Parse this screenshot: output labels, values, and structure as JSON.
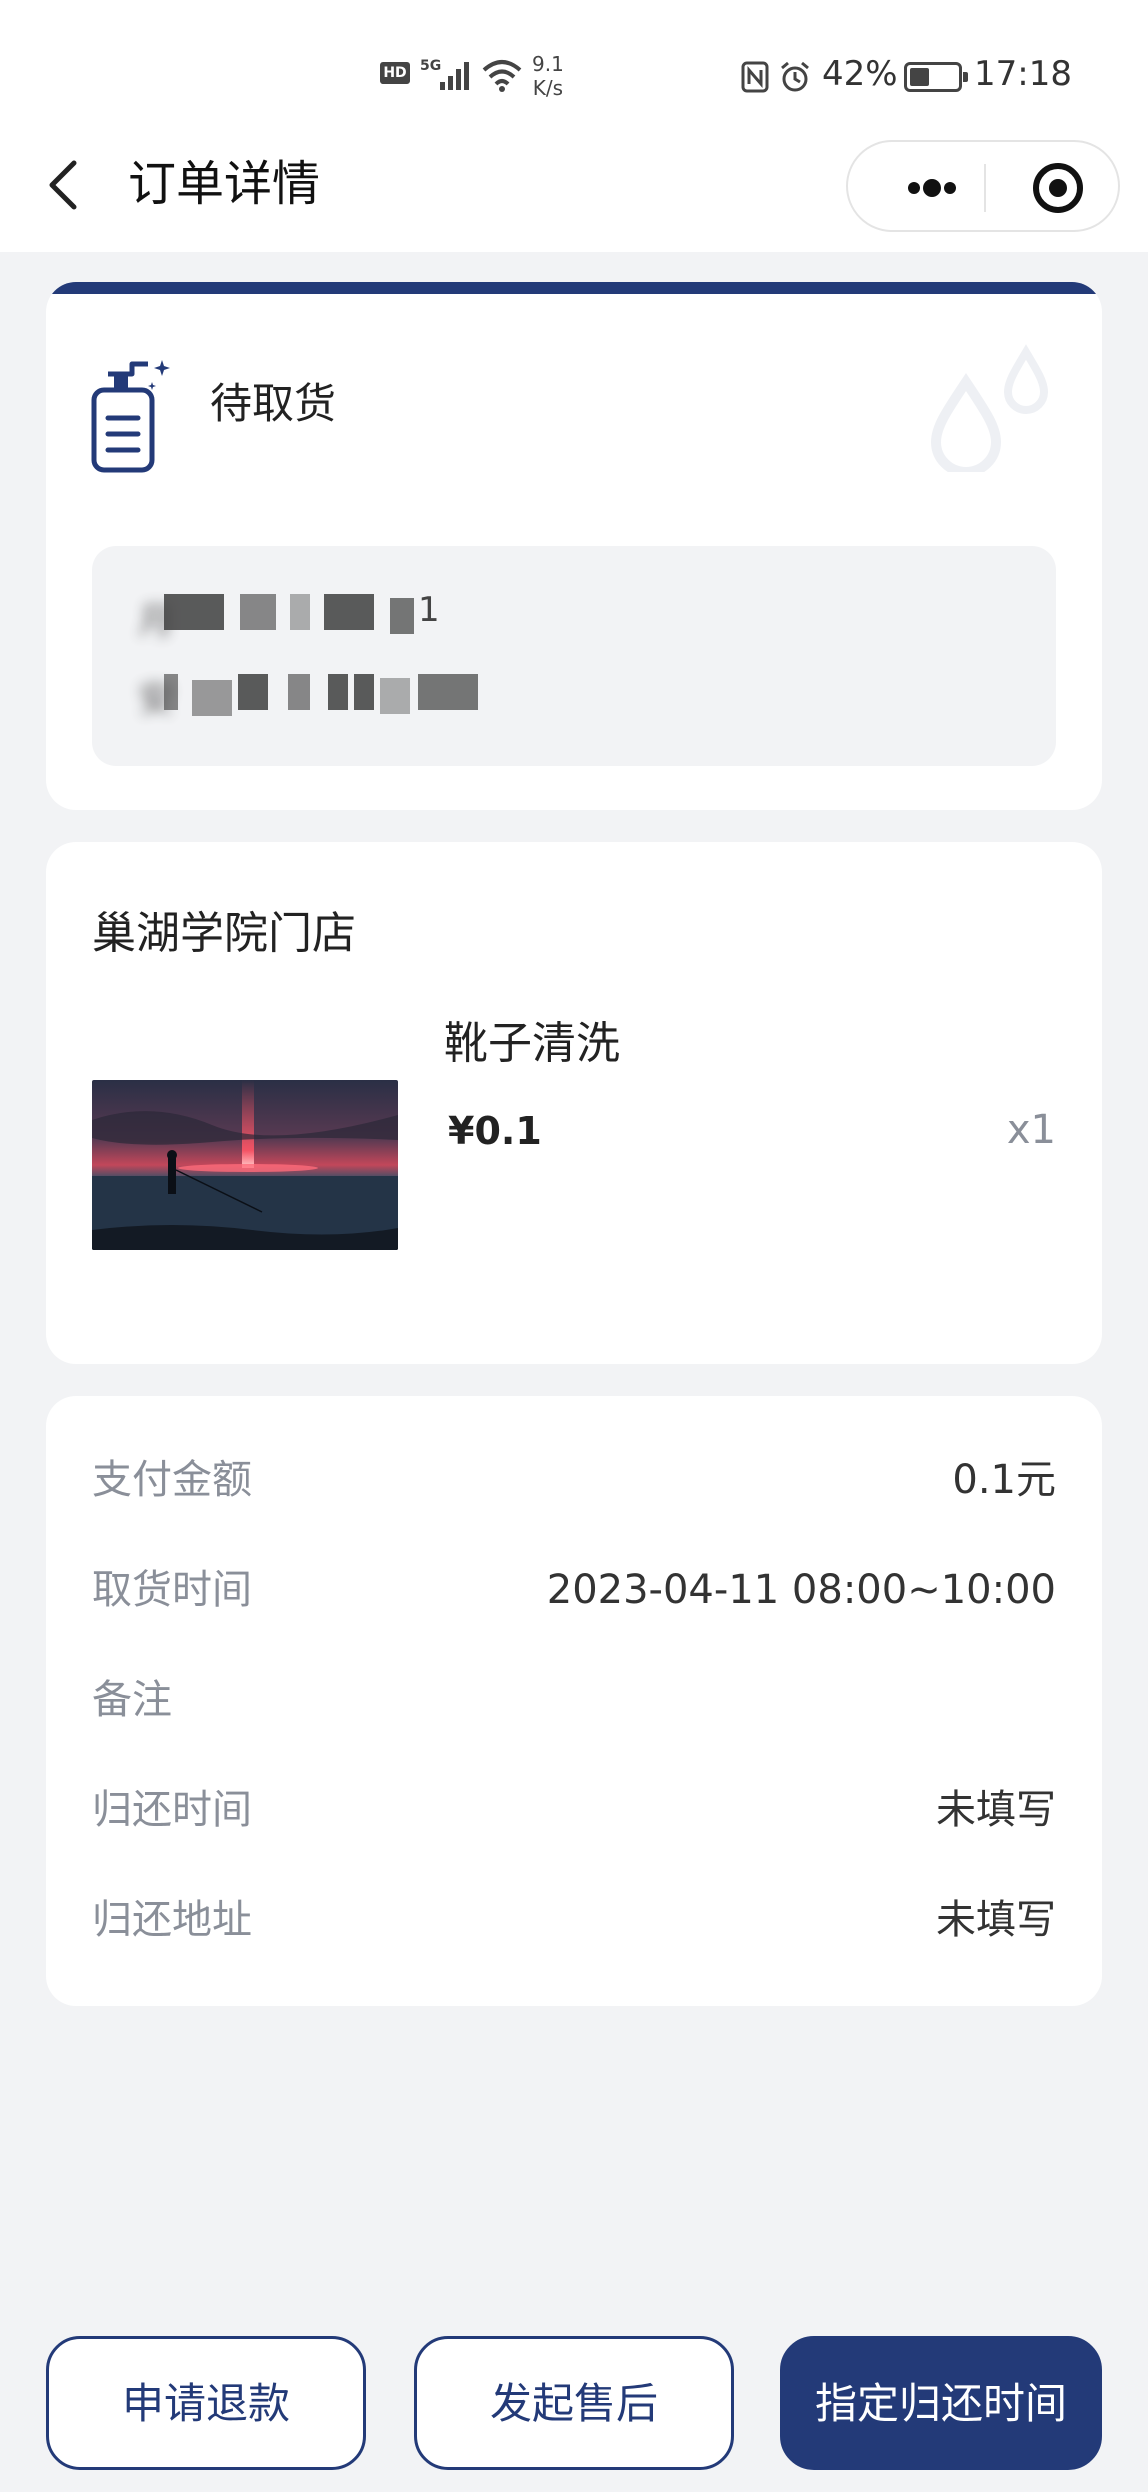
{
  "status_bar": {
    "hd": "HD",
    "network": "5G",
    "speed_value": "9.1",
    "speed_unit": "K/s",
    "battery_pct": "42%",
    "battery_level": 0.42,
    "time": "17:18"
  },
  "nav": {
    "title": "订单详情",
    "back_icon": "chevron-left-icon",
    "more_icon": "more-dots-icon",
    "close_icon": "target-icon"
  },
  "order_status": {
    "label": "待取货",
    "icon": "soap-bottle-icon",
    "accent_color": "#233a78"
  },
  "address": {
    "line1_glyph": "月",
    "line1_tail": "1",
    "line2_glyph": "安"
  },
  "store": {
    "name": "巢湖学院门店",
    "product": {
      "name": "靴子清洗",
      "price": "¥0.1",
      "quantity": "x1"
    }
  },
  "info": {
    "rows": [
      {
        "label": "支付金额",
        "value": "0.1元"
      },
      {
        "label": "取货时间",
        "value": "2023-04-11 08:00~10:00"
      },
      {
        "label": "备注",
        "value": ""
      },
      {
        "label": "归还时间",
        "value": "未填写"
      },
      {
        "label": "归还地址",
        "value": "未填写"
      }
    ]
  },
  "actions": {
    "refund": "申请退款",
    "after_sale": "发起售后",
    "set_return_time": "指定归还时间"
  },
  "colors": {
    "brand": "#233a78",
    "background": "#f2f3f5",
    "muted_text": "#8a8f99"
  }
}
